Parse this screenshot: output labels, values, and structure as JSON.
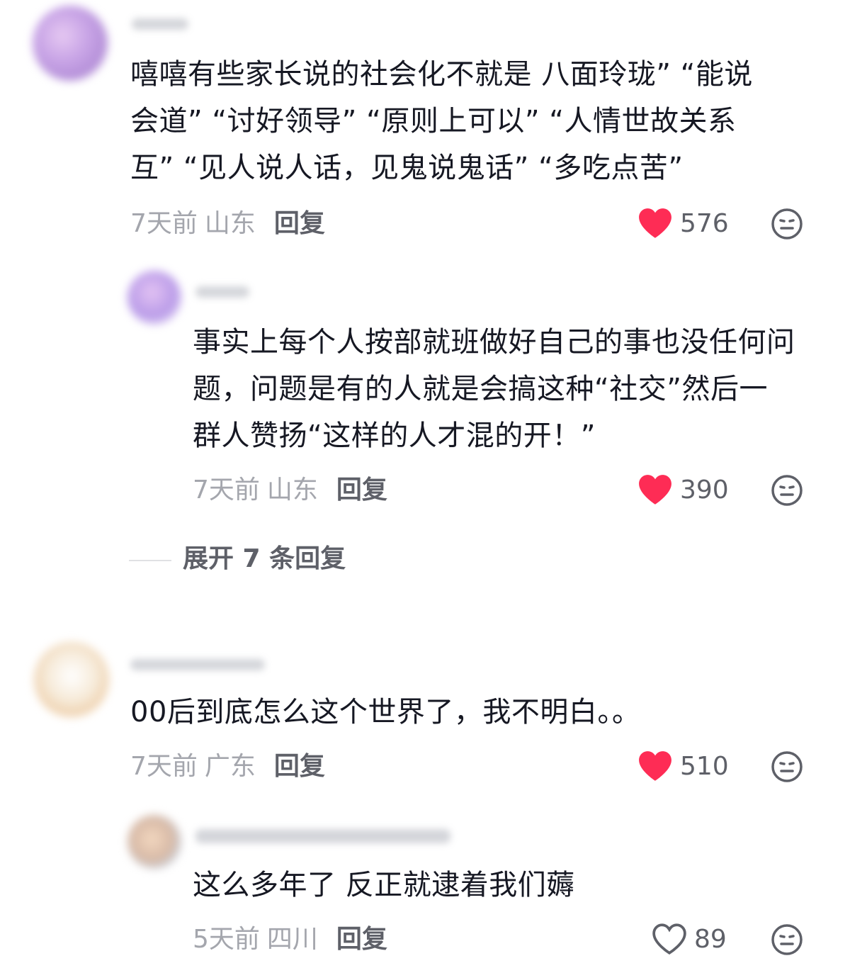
{
  "comments": [
    {
      "text": "嘻嘻有些家长说的社会化不就是  八面玲珑”  “能说\n会道”  “讨好领导”  “原则上可以”  “人情世故关系\n互”  “见人说人话，见鬼说鬼话”  “多吃点苦”",
      "time": "7天前",
      "location": "山东",
      "reply_label": "回复",
      "likes": "576",
      "liked": true
    },
    {
      "text": "事实上每个人按部就班做好自己的事也没任何问\n题，问题是有的人就是会搞这种“社交”然后一\n群人赞扬“这样的人才混的开！”",
      "time": "7天前",
      "location": "山东",
      "reply_label": "回复",
      "likes": "390",
      "liked": true
    },
    {
      "text": "00后到底怎么这个世界了，我不明白。。",
      "time": "7天前",
      "location": "广东",
      "reply_label": "回复",
      "likes": "510",
      "liked": true
    },
    {
      "text": "这么多年了 反正就逮着我们薅",
      "time": "5天前",
      "location": "四川",
      "reply_label": "回复",
      "likes": "89",
      "liked": false
    }
  ],
  "expand_replies": "展开 7 条回复",
  "colors": {
    "heart_liked": "#fe2c55",
    "heart_outline": "#5e6068",
    "meta_gray": "#a4a6ad",
    "text": "#161823"
  },
  "icons": {
    "like": "heart-icon",
    "emoji": "neutral-face-icon"
  }
}
